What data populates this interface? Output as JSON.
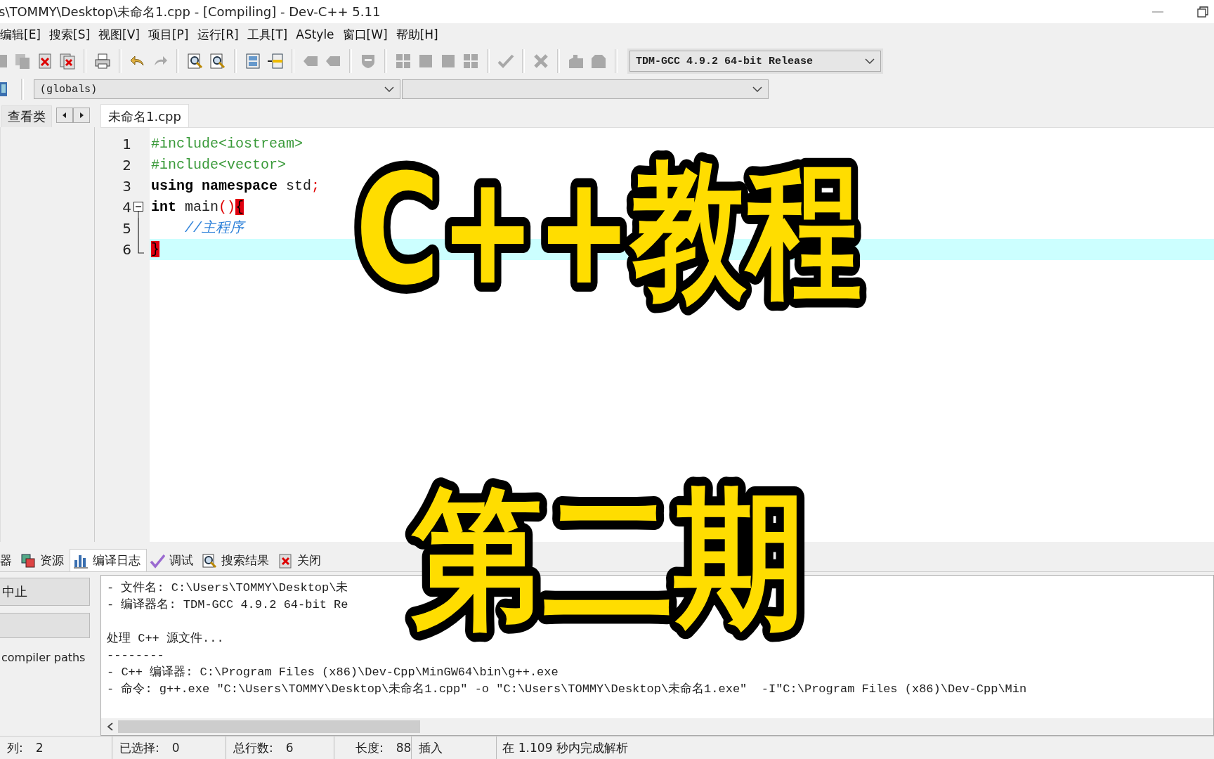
{
  "window": {
    "title": "s\\TOMMY\\Desktop\\未命名1.cpp - [Compiling] - Dev-C++ 5.11"
  },
  "menu": [
    "编辑[E]",
    "搜索[S]",
    "视图[V]",
    "项目[P]",
    "运行[R]",
    "工具[T]",
    "AStyle",
    "窗口[W]",
    "帮助[H]"
  ],
  "compiler_select": {
    "value": "TDM-GCC 4.9.2 64-bit Release"
  },
  "scope_select": {
    "value": "(globals)"
  },
  "left_panel": {
    "tab": "查看类"
  },
  "editor": {
    "tabs": [
      {
        "label": "未命名1.cpp",
        "selected": true
      }
    ],
    "lines": [
      {
        "number": "1",
        "kind": "plain",
        "current": false,
        "tokens": [
          {
            "kind": "preprocessor",
            "text": "#include<iostream>"
          }
        ]
      },
      {
        "number": "2",
        "kind": "plain",
        "current": false,
        "tokens": [
          {
            "kind": "preprocessor",
            "text": "#include<vector>"
          }
        ]
      },
      {
        "number": "3",
        "kind": "plain",
        "current": false,
        "tokens": [
          {
            "kind": "keyword",
            "text": "using namespace"
          },
          {
            "kind": "plain",
            "text": " std"
          },
          {
            "kind": "symbol",
            "text": ";"
          }
        ]
      },
      {
        "number": "4",
        "kind": "fold-start",
        "current": false,
        "tokens": [
          {
            "kind": "keyword",
            "text": "int"
          },
          {
            "kind": "plain",
            "text": " main"
          },
          {
            "kind": "symbol",
            "text": "()"
          },
          {
            "kind": "brace",
            "text": "{"
          }
        ]
      },
      {
        "number": "5",
        "kind": "fold-body",
        "current": false,
        "tokens": [
          {
            "kind": "comment",
            "text": "    //主程序"
          }
        ]
      },
      {
        "number": "6",
        "kind": "fold-end",
        "current": true,
        "tokens": [
          {
            "kind": "brace",
            "text": "}"
          }
        ]
      }
    ]
  },
  "bottom_tabs": [
    {
      "label": "器",
      "kind": "none",
      "selected": false
    },
    {
      "label": "资源",
      "kind": "resources",
      "selected": false
    },
    {
      "label": "编译日志",
      "kind": "chart",
      "selected": true
    },
    {
      "label": "调试",
      "kind": "check",
      "selected": false
    },
    {
      "label": "搜索结果",
      "kind": "search",
      "selected": false
    },
    {
      "label": "关闭",
      "kind": "close",
      "selected": false
    }
  ],
  "compile_panel": {
    "abort_button": "中止",
    "note": "compiler paths"
  },
  "log_blocks": [
    {
      "lines": [
        "- 文件名: C:\\Users\\TOMMY\\Desktop\\未",
        "- 编译器名: TDM-GCC 4.9.2 64-bit Re"
      ]
    },
    {
      "lines": [
        "处理 C++ 源文件...",
        "--------",
        "- C++ 编译器: C:\\Program Files (x86)\\Dev-Cpp\\MinGW64\\bin\\g++.exe",
        "- 命令: g++.exe \"C:\\Users\\TOMMY\\Desktop\\未命名1.cpp\" -o \"C:\\Users\\TOMMY\\Desktop\\未命名1.exe\"  -I\"C:\\Program Files (x86)\\Dev-Cpp\\Min"
      ]
    }
  ],
  "status_bar": {
    "fields": [
      {
        "label": "列:",
        "value": "2"
      },
      {
        "label": "已选择:",
        "value": "0"
      },
      {
        "label": "总行数:",
        "value": "6"
      },
      {
        "label": "长度:",
        "value": "88"
      }
    ],
    "mode": "插入",
    "message": "在 1.109 秒内完成解析"
  },
  "title_overlay": {
    "lines": [
      "C++教程",
      "第二期"
    ]
  }
}
